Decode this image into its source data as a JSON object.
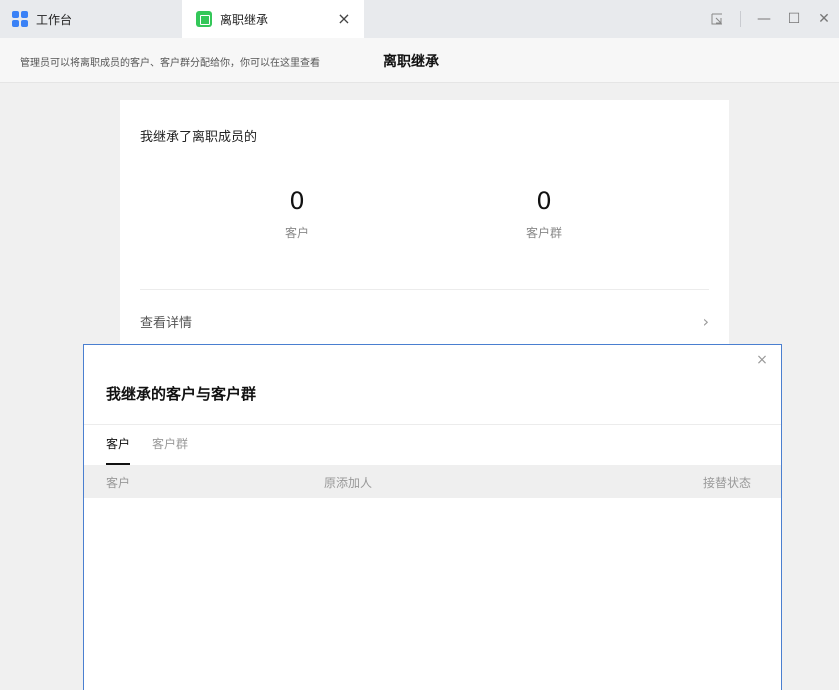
{
  "tabs": {
    "workbench": {
      "label": "工作台",
      "icon": "grid-icon"
    },
    "active": {
      "label": "离职继承",
      "icon": "document-icon",
      "close": "×"
    }
  },
  "window_controls": {
    "minimize": "—",
    "maximize": "☐",
    "close": "✕"
  },
  "subheader": {
    "hint": "管理员可以将离职成员的客户、客户群分配给你，你可以在这里查看",
    "title": "离职继承"
  },
  "card": {
    "heading": "我继承了离职成员的",
    "stats": [
      {
        "value": "0",
        "label": "客户"
      },
      {
        "value": "0",
        "label": "客户群"
      }
    ],
    "details_label": "查看详情",
    "chevron": "›"
  },
  "modal": {
    "close": "×",
    "title": "我继承的客户与客户群",
    "tabs": [
      {
        "label": "客户",
        "active": true
      },
      {
        "label": "客户群",
        "active": false
      }
    ],
    "columns": [
      "客户",
      "原添加人",
      "接替状态"
    ],
    "rows": []
  },
  "colors": {
    "accent_blue": "#3b82f6",
    "tab_icon_green": "#34c759",
    "modal_border": "#4a7fd0"
  }
}
